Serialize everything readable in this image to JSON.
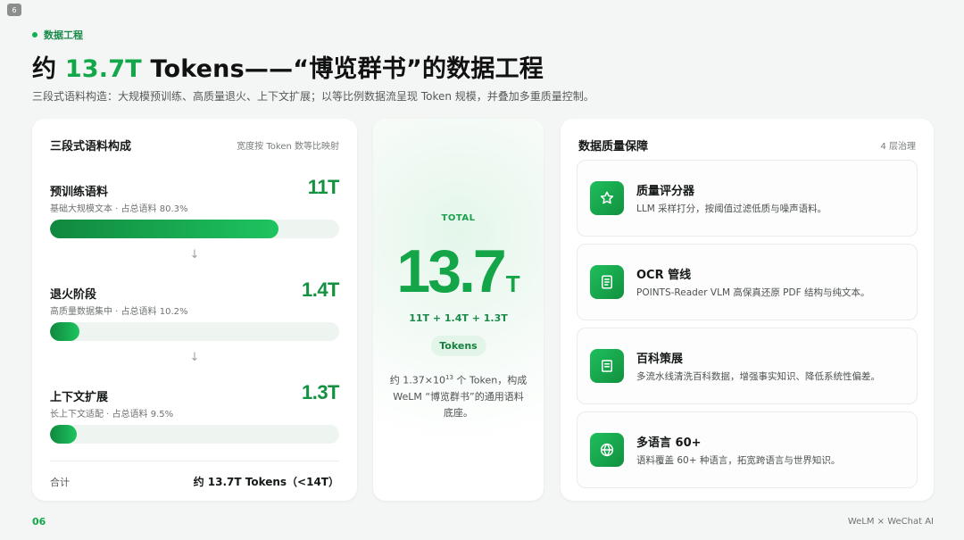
{
  "page_badge": "6",
  "eyebrow": "数据工程",
  "title": {
    "prefix": "约 ",
    "accent": "13.7T",
    "suffix": " Tokens——“博览群书”的数据工程"
  },
  "subtitle": "三段式语料构造：大规模预训练、高质量退火、上下文扩展；以等比例数据流呈现 Token 规模，并叠加多重质量控制。",
  "composition": {
    "title": "三段式语料构成",
    "note": "宽度按 Token 数等比映射",
    "segments": [
      {
        "name": "预训练语料",
        "value": "11T",
        "desc": "基础大规模文本 · 占总语料 80.3%",
        "share": 0.803
      },
      {
        "name": "退火阶段",
        "value": "1.4T",
        "desc": "高质量数据集中 · 占总语料 10.2%",
        "share": 0.102
      },
      {
        "name": "上下文扩展",
        "value": "1.3T",
        "desc": "长上下文适配 · 占总语料 9.5%",
        "share": 0.095
      }
    ],
    "arrow": "↓",
    "total_label": "合计",
    "total_value": "约 13.7T Tokens（<14T）"
  },
  "total_card": {
    "label": "TOTAL",
    "number": "13.7",
    "unit": "T",
    "formula": "11T + 1.4T + 1.3T",
    "pill": "Tokens",
    "desc_before": "约 1.37×10",
    "desc_exp": "13",
    "desc_after": " 个 Token，构成 WeLM “博览群书”的通用语料底座。"
  },
  "quality": {
    "title": "数据质量保障",
    "note": "4 层治理",
    "items": [
      {
        "icon": "star-icon",
        "title": "质量评分器",
        "desc": "LLM 采样打分，按阈值过滤低质与噪声语料。"
      },
      {
        "icon": "document-icon",
        "title": "OCR 管线",
        "desc": "POINTS-Reader VLM 高保真还原 PDF 结构与纯文本。"
      },
      {
        "icon": "book-icon",
        "title": "百科策展",
        "desc": "多流水线清洗百科数据，增强事实知识、降低系统性偏差。"
      },
      {
        "icon": "globe-icon",
        "title": "多语言 60+",
        "desc": "语料覆盖 60+ 种语言，拓宽跨语言与世界知识。"
      }
    ]
  },
  "footer": {
    "page": "06",
    "brand": "WeLM × WeChat AI"
  },
  "colors": {
    "accent": "#12a84a",
    "bar_start": "#10883f",
    "bar_end": "#1ec45f"
  }
}
